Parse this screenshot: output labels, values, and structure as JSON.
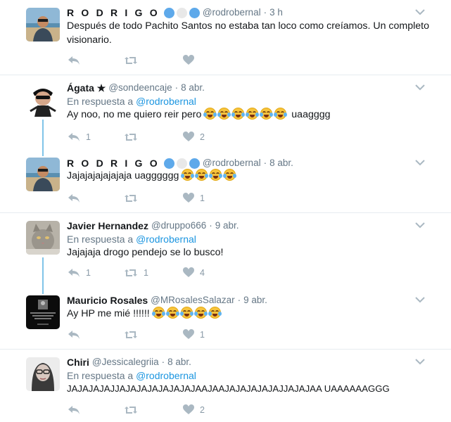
{
  "tweets": [
    {
      "name": "R O D R I G O",
      "handle": "@rodrobernal",
      "time": "3 h",
      "reply_prefix": "",
      "reply_mention": "",
      "text": "Después de todo Pachito Santos no estaba tan loco como creíamos. Un completo visionario.",
      "text_suffix": "",
      "emoji_count": 0,
      "replies": "",
      "retweets": "",
      "likes": ""
    },
    {
      "name": "Ágata ★",
      "handle": "@sondeencaje",
      "time": "8 abr.",
      "reply_prefix": "En respuesta a",
      "reply_mention": "@rodrobernal",
      "text": "Ay noo, no me quiero reir pero",
      "text_suffix": "uaagggg",
      "emoji_count": 6,
      "replies": "1",
      "retweets": "",
      "likes": "2"
    },
    {
      "name": "R O D R I G O",
      "handle": "@rodrobernal",
      "time": "8 abr.",
      "reply_prefix": "",
      "reply_mention": "",
      "text": "Jajajajajajajaja uagggggg",
      "text_suffix": "",
      "emoji_count": 4,
      "replies": "",
      "retweets": "",
      "likes": "1"
    },
    {
      "name": "Javier Hernandez",
      "handle": "@druppo666",
      "time": "9 abr.",
      "reply_prefix": "En respuesta a",
      "reply_mention": "@rodrobernal",
      "text": "Jajajaja drogo pendejo se lo busco!",
      "text_suffix": "",
      "emoji_count": 0,
      "replies": "1",
      "retweets": "1",
      "likes": "4"
    },
    {
      "name": "Mauricio Rosales",
      "handle": "@MRosalesSalazar",
      "time": "9 abr.",
      "reply_prefix": "",
      "reply_mention": "",
      "text": "Ay HP me mié !!!!!!",
      "text_suffix": "",
      "emoji_count": 5,
      "replies": "",
      "retweets": "",
      "likes": "1"
    },
    {
      "name": "Chiri",
      "handle": "@Jessicalegriia",
      "time": "8 abr.",
      "reply_prefix": "En respuesta a",
      "reply_mention": "@rodrobernal",
      "text": "JAJAJAJAJJAJAJAJAJAJAJAJAAJAAJAJAJAJAJAJJAJAJAA UAAAAAAGGG",
      "text_suffix": "",
      "emoji_count": 0,
      "replies": "",
      "retweets": "",
      "likes": "2"
    }
  ],
  "colors": {
    "accent": "#1b95e0",
    "muted": "#657786",
    "icon": "#aab8c2",
    "thread_line": "#80c4e8",
    "separator": "#e6ecf0",
    "emoji": "#f7c43d"
  },
  "icons": {
    "reply": "reply-icon",
    "retweet": "retweet-icon",
    "like": "heart-icon",
    "more": "chevron-down-icon",
    "badge": "circle-badge"
  }
}
